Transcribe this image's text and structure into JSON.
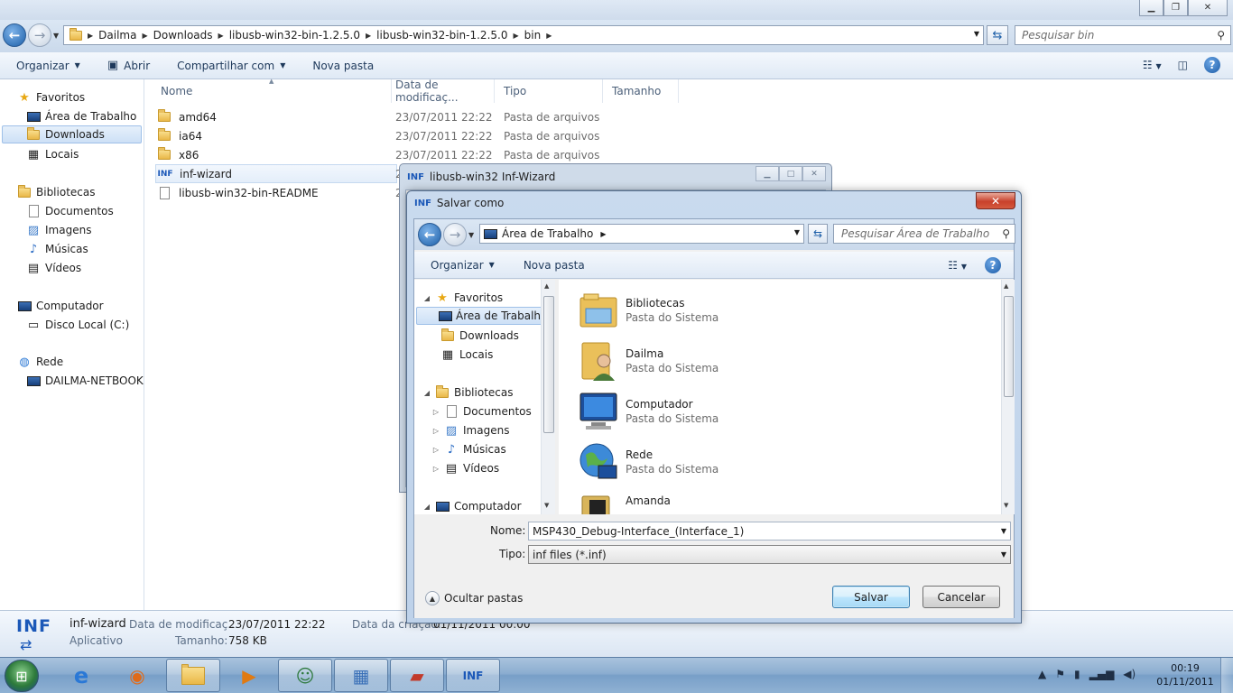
{
  "explorer": {
    "breadcrumb": [
      "Dailma",
      "Downloads",
      "libusb-win32-bin-1.2.5.0",
      "libusb-win32-bin-1.2.5.0",
      "bin"
    ],
    "search_placeholder": "Pesquisar bin",
    "toolbar": {
      "organize": "Organizar",
      "open": "Abrir",
      "share": "Compartilhar com",
      "new_folder": "Nova pasta"
    },
    "nav": {
      "favorites": "Favoritos",
      "desktop": "Área de Trabalho",
      "downloads": "Downloads",
      "places": "Locais",
      "libraries": "Bibliotecas",
      "documents": "Documentos",
      "images": "Imagens",
      "music": "Músicas",
      "videos": "Vídeos",
      "computer": "Computador",
      "local_disk": "Disco Local (C:)",
      "network": "Rede",
      "netbook": "DAILMA-NETBOOK"
    },
    "columns": [
      "Nome",
      "Data de modificaç...",
      "Tipo",
      "Tamanho"
    ],
    "files": [
      {
        "name": "amd64",
        "date": "23/07/2011 22:22",
        "type": "Pasta de arquivos"
      },
      {
        "name": "ia64",
        "date": "23/07/2011 22:22",
        "type": "Pasta de arquivos"
      },
      {
        "name": "x86",
        "date": "23/07/2011 22:22",
        "type": "Pasta de arquivos"
      },
      {
        "name": "inf-wizard",
        "date": "2",
        "type": ""
      },
      {
        "name": "libusb-win32-bin-README",
        "date": "2",
        "type": ""
      }
    ],
    "details": {
      "icon_text": "INF",
      "name": "inf-wizard",
      "type": "Aplicativo",
      "modified_label": "Data de modificaç...",
      "modified_value": "23/07/2011 22:22",
      "size_label": "Tamanho:",
      "size_value": "758 KB",
      "created_label": "Data da criação:",
      "created_value": "01/11/2011 00:00"
    }
  },
  "wizard": {
    "title": "libusb-win32 Inf-Wizard"
  },
  "saveas": {
    "title": "Salvar como",
    "close": "✕",
    "location": "Área de Trabalho",
    "search_placeholder": "Pesquisar Área de Trabalho",
    "toolbar": {
      "organize": "Organizar",
      "new_folder": "Nova pasta"
    },
    "nav": {
      "favorites": "Favoritos",
      "desktop": "Área de Trabalho",
      "downloads": "Downloads",
      "places": "Locais",
      "libraries": "Bibliotecas",
      "documents": "Documentos",
      "images": "Imagens",
      "music": "Músicas",
      "videos": "Vídeos",
      "computer": "Computador"
    },
    "items": [
      {
        "name": "Bibliotecas",
        "sub": "Pasta do Sistema"
      },
      {
        "name": "Dailma",
        "sub": "Pasta do Sistema"
      },
      {
        "name": "Computador",
        "sub": "Pasta do Sistema"
      },
      {
        "name": "Rede",
        "sub": "Pasta do Sistema"
      },
      {
        "name": "Amanda",
        "sub": ""
      }
    ],
    "name_label": "Nome:",
    "name_value": "MSP430_Debug-Interface_(Interface_1)",
    "type_label": "Tipo:",
    "type_value": "inf files (*.inf)",
    "hide_folders": "Ocultar pastas",
    "save": "Salvar",
    "cancel": "Cancelar"
  },
  "taskbar": {
    "time": "00:19",
    "date": "01/11/2011",
    "inf_label": "INF"
  },
  "colors": {
    "accent": "#1b58b8",
    "selection": "#cde0f6"
  }
}
